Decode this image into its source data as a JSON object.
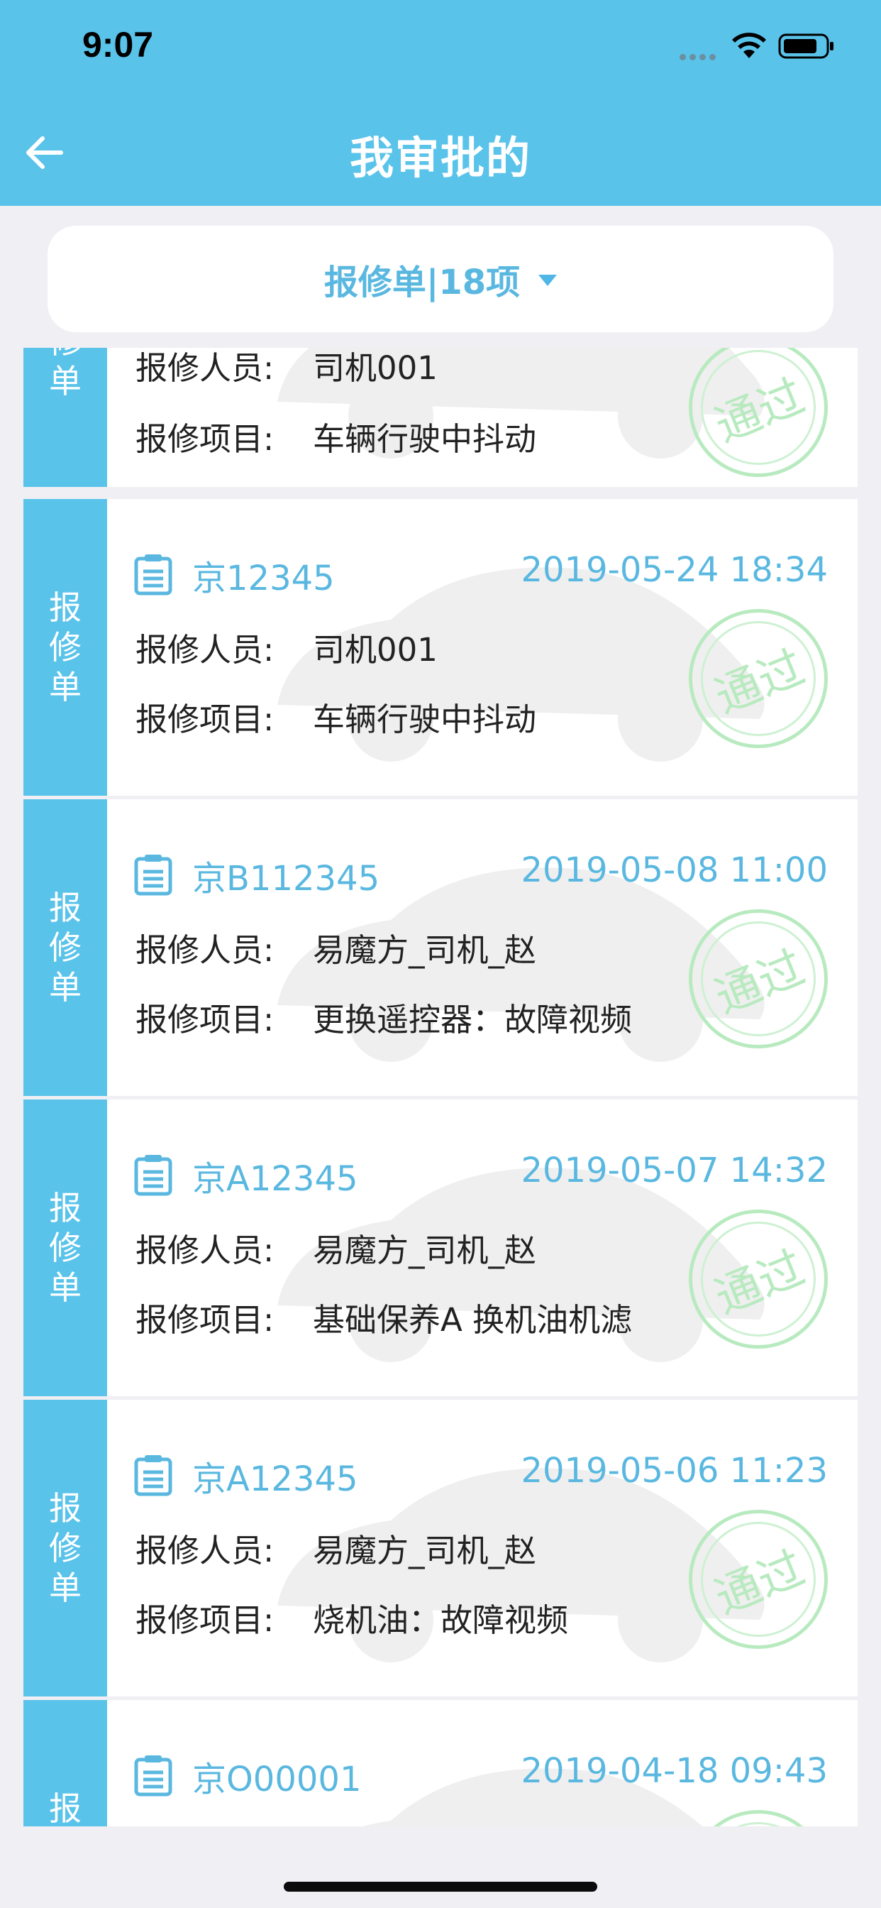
{
  "status_bar": {
    "time": "9:07"
  },
  "nav": {
    "title": "我审批的"
  },
  "filter": {
    "label": "报修单|18项"
  },
  "labels": {
    "side": [
      "报",
      "修",
      "单"
    ],
    "reporter": "报修人员:",
    "item": "报修项目:",
    "stamp": "通过"
  },
  "cards": [
    {
      "plate": "",
      "date": "",
      "reporter": "司机001",
      "item": "车辆行驶中抖动"
    },
    {
      "plate": "京12345",
      "date": "2019-05-24 18:34",
      "reporter": "司机001",
      "item": "车辆行驶中抖动"
    },
    {
      "plate": "京B112345",
      "date": "2019-05-08 11:00",
      "reporter": "易魔方_司机_赵",
      "item": "更换遥控器：故障视频"
    },
    {
      "plate": "京A12345",
      "date": "2019-05-07 14:32",
      "reporter": "易魔方_司机_赵",
      "item": "基础保养A  换机油机滤"
    },
    {
      "plate": "京A12345",
      "date": "2019-05-06 11:23",
      "reporter": "易魔方_司机_赵",
      "item": "烧机油：故障视频"
    },
    {
      "plate": "京O00001",
      "date": "2019-04-18 09:43",
      "reporter": "",
      "item": ""
    }
  ],
  "colors": {
    "primary": "#5ac3ea",
    "accent_text": "#5ab8e0",
    "stamp_green": "#b8eabf"
  }
}
